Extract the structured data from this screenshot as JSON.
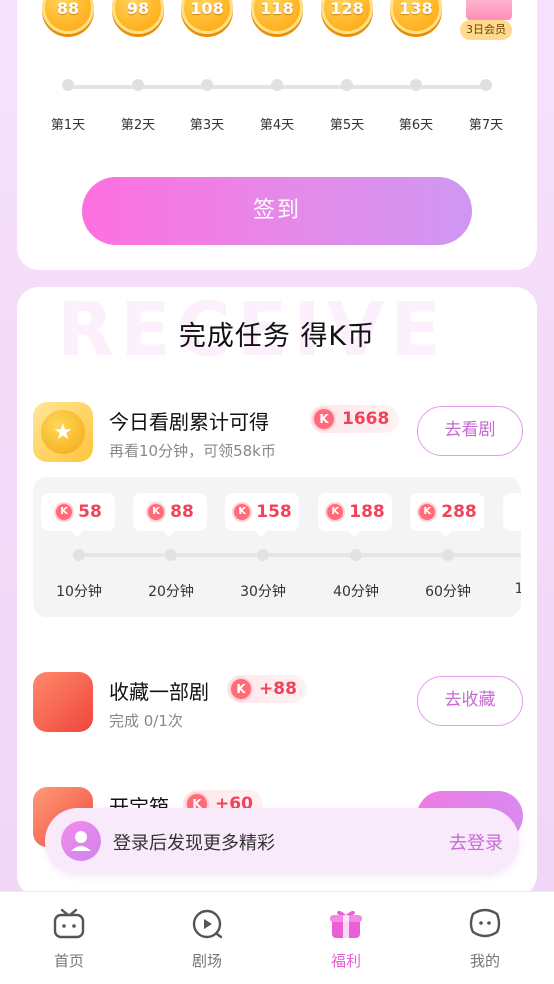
{
  "checkin": {
    "coins": [
      "88",
      "98",
      "108",
      "118",
      "128",
      "138"
    ],
    "vip_label": "3日会员",
    "days": [
      "第1天",
      "第2天",
      "第3天",
      "第4天",
      "第5天",
      "第6天",
      "第7天"
    ],
    "sign_button": "签到"
  },
  "tasks": {
    "watermark": "RECEIVE",
    "title_prefix": "完成任务 ",
    "title_highlight": "得K币",
    "k_badge": "K",
    "watch": {
      "name": "今日看剧累计可得",
      "reward": "1668",
      "sub": "再看10分钟，可领58k币",
      "button": "去看剧"
    },
    "milestones": [
      {
        "reward": "58",
        "label": "10分钟"
      },
      {
        "reward": "88",
        "label": "20分钟"
      },
      {
        "reward": "158",
        "label": "30分钟"
      },
      {
        "reward": "188",
        "label": "40分钟"
      },
      {
        "reward": "288",
        "label": "60分钟"
      },
      {
        "reward": "",
        "label": "1"
      }
    ],
    "collect": {
      "name": "收藏一部剧",
      "reward": "+88",
      "sub": "完成 0/1次",
      "button": "去收藏"
    },
    "chest": {
      "name": "开宝箱",
      "reward": "+60"
    }
  },
  "login": {
    "text": "登录后发现更多精彩",
    "link": "去登录"
  },
  "nav": [
    {
      "label": "首页",
      "icon": "tv-icon",
      "active": false
    },
    {
      "label": "剧场",
      "icon": "theater-icon",
      "active": false
    },
    {
      "label": "福利",
      "icon": "gift-icon",
      "active": true
    },
    {
      "label": "我的",
      "icon": "profile-icon",
      "active": false
    }
  ],
  "colors": {
    "accent": "#ea5fd6",
    "reward_red": "#f0435a",
    "coin_gold": "#ffae1a"
  }
}
